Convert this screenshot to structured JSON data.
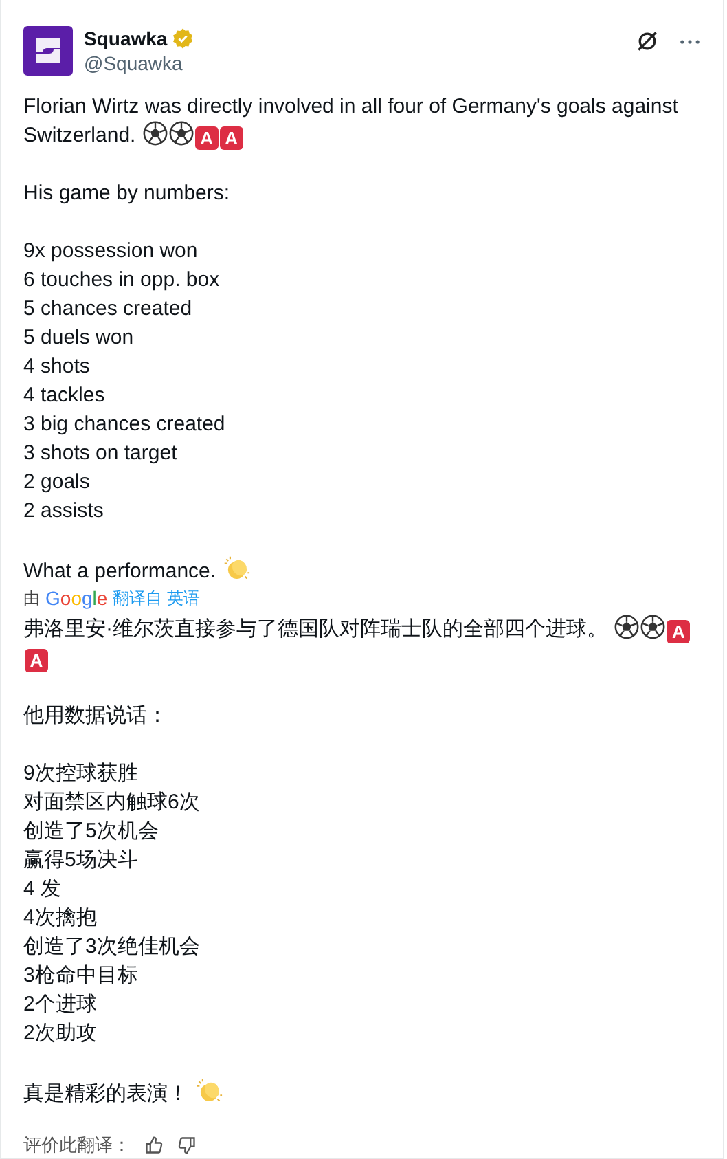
{
  "post": {
    "author": "Squawka",
    "handle": "@Squawka",
    "verified": true
  },
  "original": [
    {
      "text_lines": [
        "Florian Wirtz was directly involved in all four of Germany's goals against",
        "Switzerland."
      ],
      "emoji": [
        {
          "kind": "ball"
        },
        {
          "kind": "ball"
        },
        {
          "kind": "letter",
          "text": "A"
        },
        {
          "kind": "letter",
          "text": "A"
        }
      ]
    },
    {
      "text": "His game by numbers:"
    },
    {
      "lines": [
        "9x possession won",
        "6 touches in opp. box",
        "5 chances created",
        "5 duels won",
        "4 shots",
        "4 tackles",
        "3 big chances created",
        "3 shots on target",
        "2 goals",
        "2 assists"
      ]
    },
    {
      "text": "What a performance.",
      "emoji": [
        {
          "kind": "clap"
        }
      ]
    }
  ],
  "translation_bar": {
    "prefix": "由",
    "provider": "Google",
    "label": "翻译自 英语"
  },
  "translated": [
    {
      "text": "弗洛里安·维尔茨直接参与了德国队对阵瑞士队的全部四个进球。",
      "emoji": [
        {
          "kind": "ball"
        },
        {
          "kind": "ball"
        },
        {
          "kind": "letter",
          "text": "A"
        },
        {
          "kind": "letter",
          "text": "A"
        }
      ]
    },
    {
      "text": "他用数据说话："
    },
    {
      "lines": [
        "9次控球获胜",
        "对面禁区内触球6次",
        "创造了5次机会",
        "赢得5场决斗",
        "4 发",
        "4次擒抱",
        "创造了3次绝佳机会",
        "3枪命中目标",
        "2个进球",
        "2次助攻"
      ]
    },
    {
      "text": "真是精彩的表演！",
      "emoji": [
        {
          "kind": "clap"
        }
      ]
    }
  ],
  "rating": {
    "label": "评价此翻译："
  }
}
